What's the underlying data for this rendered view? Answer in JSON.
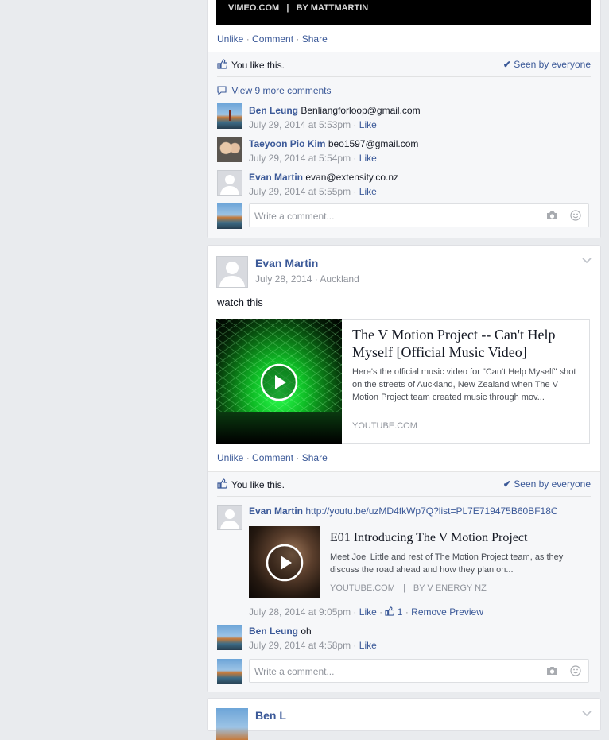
{
  "post1": {
    "video_caption": "VIMEO.COM   |   BY MATTMARTIN",
    "actions": {
      "unlike": "Unlike",
      "comment": "Comment",
      "share": "Share",
      "sep": " · "
    },
    "you_like": "You like this.",
    "seen": "Seen by everyone",
    "view_more": "View 9 more comments",
    "comments": [
      {
        "name": "Ben Leung",
        "text": "Benliangforloop@gmail.com",
        "time": "July 29, 2014 at 5:53pm",
        "like": "Like"
      },
      {
        "name": "Taeyoon Pio Kim",
        "text": "beo1597@gmail.com",
        "time": "July 29, 2014 at 5:54pm",
        "like": "Like"
      },
      {
        "name": "Evan Martin",
        "text": "evan@extensity.co.nz",
        "time": "July 29, 2014 at 5:55pm",
        "like": "Like"
      }
    ],
    "placeholder": "Write a comment..."
  },
  "post2": {
    "author": "Evan Martin",
    "date": "July 28, 2014",
    "location": "Auckland",
    "text": "watch this",
    "link": {
      "title": "The V Motion Project -- Can't Help Myself [Official Music Video]",
      "desc": "Here's the official music video for \"Can't Help Myself\" shot on the streets of Auckland, New Zealand when The V Motion Project team created music through mov...",
      "source": "YOUTUBE.COM"
    },
    "actions": {
      "unlike": "Unlike",
      "comment": "Comment",
      "share": "Share",
      "sep": " · "
    },
    "you_like": "You like this.",
    "seen": "Seen by everyone",
    "comment1": {
      "name": "Evan Martin",
      "url": "http://youtu.be/uzMD4fkWp7Q?list=PL7E719475B60BF18C",
      "preview": {
        "title": "E01 Introducing The V Motion Project",
        "desc": "Meet Joel Little and rest of The Motion Project team, as they discuss the road ahead and how they plan on...",
        "source": "YOUTUBE.COM",
        "by": "BY V ENERGY NZ",
        "sep": "|"
      },
      "time": "July 28, 2014 at 9:05pm",
      "like": "Like",
      "like_count": "1",
      "remove": "Remove Preview"
    },
    "comment2": {
      "name": "Ben Leung",
      "text": "oh",
      "time": "July 29, 2014 at 4:58pm",
      "like": "Like"
    },
    "placeholder": "Write a comment..."
  },
  "post3": {
    "author_partial": "Ben L"
  },
  "colors": {
    "link": "#3b5998",
    "meta": "#90949c",
    "bg": "#e9ebee",
    "green": "#1aff3a"
  }
}
